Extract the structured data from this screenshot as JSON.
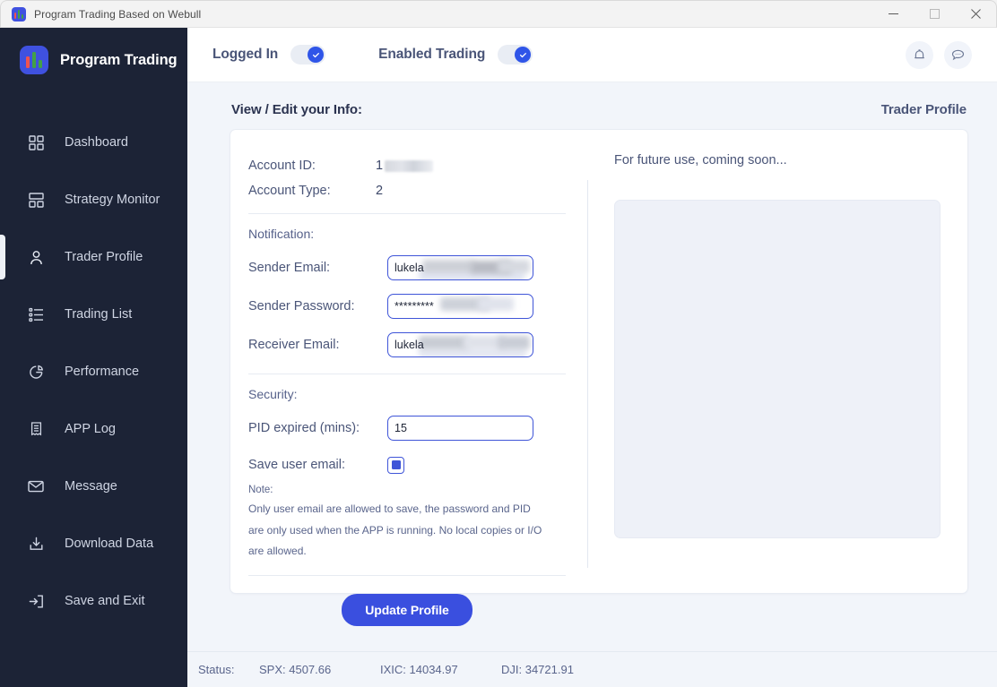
{
  "window": {
    "title": "Program Trading Based on Webull",
    "minimize_label": "Minimize",
    "maximize_label": "Maximize",
    "close_label": "Close"
  },
  "sidebar": {
    "brand": "Program Trading",
    "items": [
      {
        "label": "Dashboard",
        "icon": "grid-icon",
        "active": false
      },
      {
        "label": "Strategy Monitor",
        "icon": "layout-icon",
        "active": false
      },
      {
        "label": "Trader Profile",
        "icon": "user-icon",
        "active": true
      },
      {
        "label": "Trading List",
        "icon": "list-icon",
        "active": false
      },
      {
        "label": "Performance",
        "icon": "pie-chart-icon",
        "active": false
      },
      {
        "label": "APP Log",
        "icon": "receipt-icon",
        "active": false
      },
      {
        "label": "Message",
        "icon": "envelope-icon",
        "active": false
      },
      {
        "label": "Download Data",
        "icon": "download-icon",
        "active": false
      },
      {
        "label": "Save and Exit",
        "icon": "exit-icon",
        "active": false
      }
    ]
  },
  "topbar": {
    "toggles": [
      {
        "label": "Logged In",
        "state": "on"
      },
      {
        "label": "Enabled Trading",
        "state": "on"
      }
    ],
    "actions": [
      {
        "name": "notifications",
        "icon": "bell-icon"
      },
      {
        "name": "messages",
        "icon": "chat-icon"
      }
    ]
  },
  "content": {
    "heading": "View / Edit your Info:",
    "section": "Trader Profile",
    "account": {
      "id_label": "Account ID:",
      "id_value": "1",
      "type_label": "Account Type:",
      "type_value": "2"
    },
    "notification": {
      "title": "Notification:",
      "sender_email_label": "Sender Email:",
      "sender_email_value": "lukela",
      "sender_password_label": "Sender Password:",
      "sender_password_value": "*********",
      "receiver_email_label": "Receiver Email:",
      "receiver_email_value": "lukela"
    },
    "security": {
      "title": "Security:",
      "pid_label": "PID expired (mins):",
      "pid_value": "15",
      "save_email_label": "Save user email:",
      "save_email_checked": true,
      "note_title": "Note:",
      "note_lines": [
        "Only user email are allowed to save, the password and PID",
        "are only used when the APP is running. No local copies or I/O",
        "are allowed."
      ]
    },
    "update_button": "Update Profile",
    "right_panel": {
      "text": "For future use, coming soon..."
    }
  },
  "statusbar": {
    "label": "Status:",
    "items": [
      "SPX: 4507.66",
      "IXIC: 14034.97",
      "DJI: 34721.91"
    ]
  },
  "colors": {
    "sidebar_bg": "#1c2336",
    "accent": "#3a4fdf",
    "toggle_on": "#2f55e8",
    "canvas": "#f2f5fa"
  }
}
